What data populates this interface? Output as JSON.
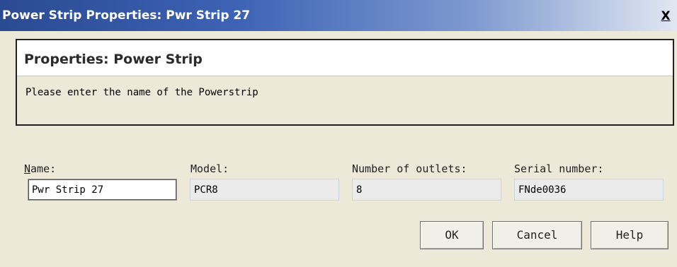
{
  "window": {
    "title": "Power Strip Properties: Pwr Strip 27",
    "close_label": "X"
  },
  "panel": {
    "heading": "Properties: Power Strip",
    "description": "Please enter the name of the Powerstrip"
  },
  "fields": {
    "name": {
      "label_accel": "N",
      "label_rest": "ame:",
      "value": "Pwr Strip 27"
    },
    "model": {
      "label": "Model:",
      "value": "PCR8"
    },
    "outlets": {
      "label": "Number of outlets:",
      "value": "8"
    },
    "serial": {
      "label": "Serial number:",
      "value": "FNde0036"
    }
  },
  "buttons": {
    "ok": "OK",
    "cancel": "Cancel",
    "help": "Help"
  }
}
